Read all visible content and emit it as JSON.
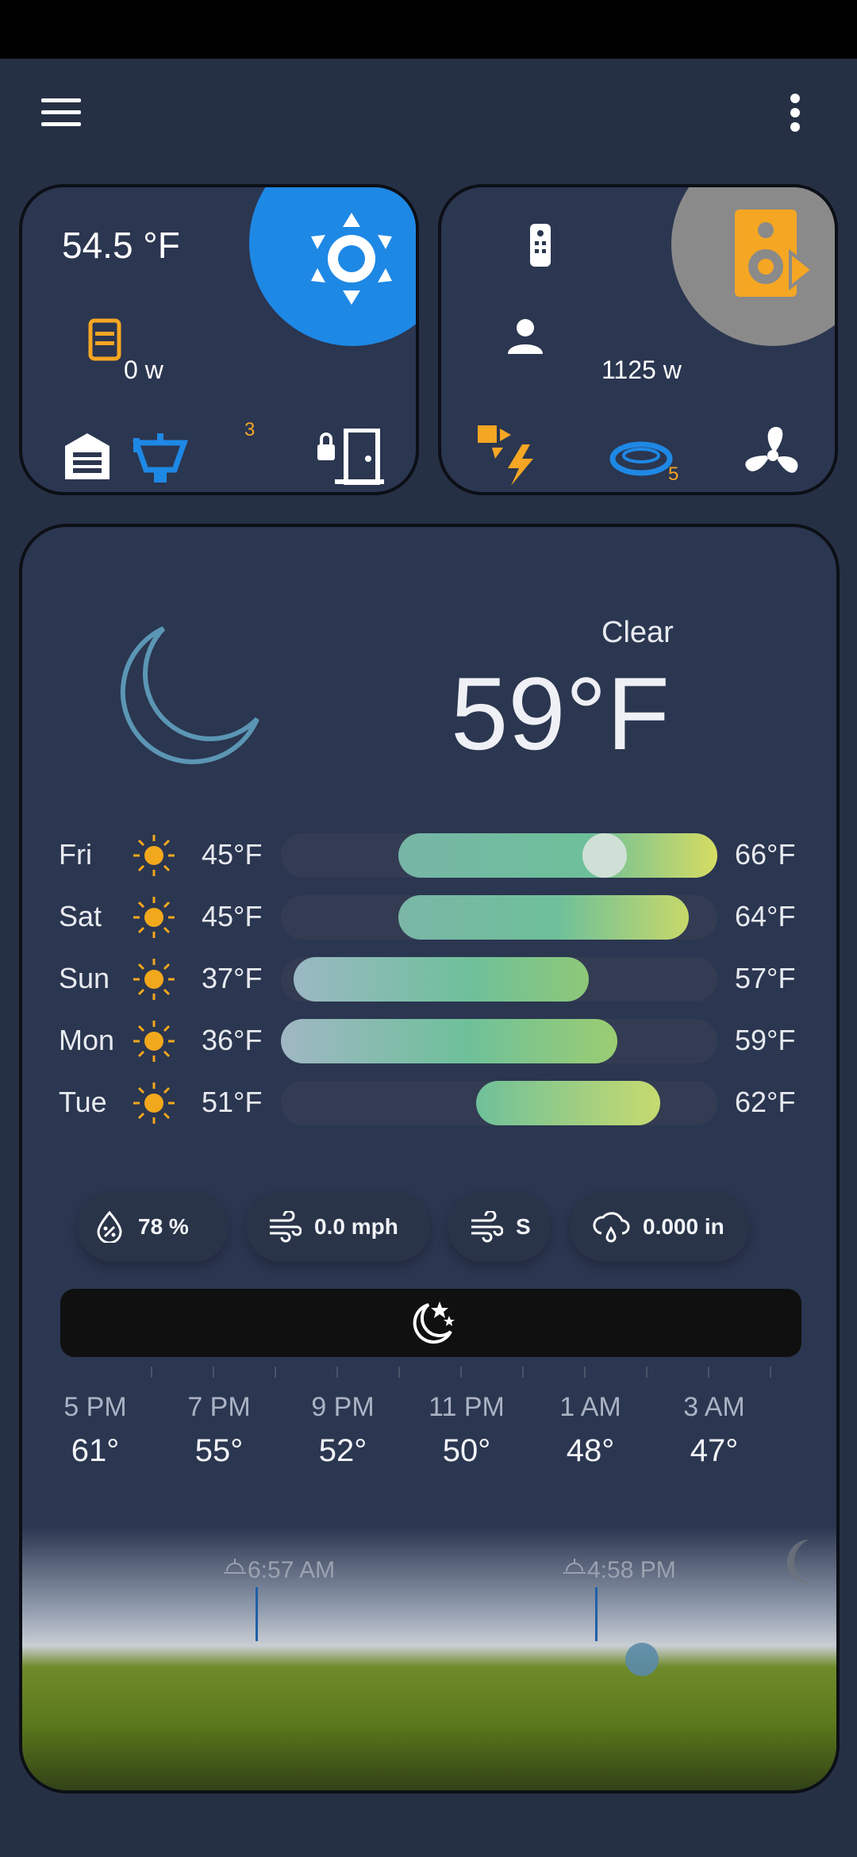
{
  "header": {
    "menu_icon": "hamburger-menu-icon",
    "more_icon": "more-vert-icon"
  },
  "card1": {
    "temperature": "54.5 °F",
    "power": "0 w",
    "light_badge": "3"
  },
  "card2": {
    "power": "1125 w",
    "pool_badge": "5"
  },
  "weather": {
    "condition": "Clear",
    "temperature": "59°F",
    "forecast": [
      {
        "day": "Fri",
        "low": "45°F",
        "high": "66°F"
      },
      {
        "day": "Sat",
        "low": "45°F",
        "high": "64°F"
      },
      {
        "day": "Sun",
        "low": "37°F",
        "high": "57°F"
      },
      {
        "day": "Mon",
        "low": "36°F",
        "high": "59°F"
      },
      {
        "day": "Tue",
        "low": "51°F",
        "high": "62°F"
      }
    ],
    "stats": {
      "humidity": "78 %",
      "wind_speed": "0.0 mph",
      "wind_direction": "S",
      "precipitation": "0.000 in"
    },
    "hourly": [
      {
        "time": "5 PM",
        "temp": "61°"
      },
      {
        "time": "7 PM",
        "temp": "55°"
      },
      {
        "time": "9 PM",
        "temp": "52°"
      },
      {
        "time": "11 PM",
        "temp": "50°"
      },
      {
        "time": "1 AM",
        "temp": "48°"
      },
      {
        "time": "3 AM",
        "temp": "47°"
      }
    ],
    "sunrise": "6:57 AM",
    "sunset": "4:58 PM"
  },
  "colors": {
    "background": "#263045",
    "card": "#2b3650",
    "accent_blue": "#1e88e5",
    "accent_orange": "#f5a623",
    "moon": "#5b96b4"
  }
}
